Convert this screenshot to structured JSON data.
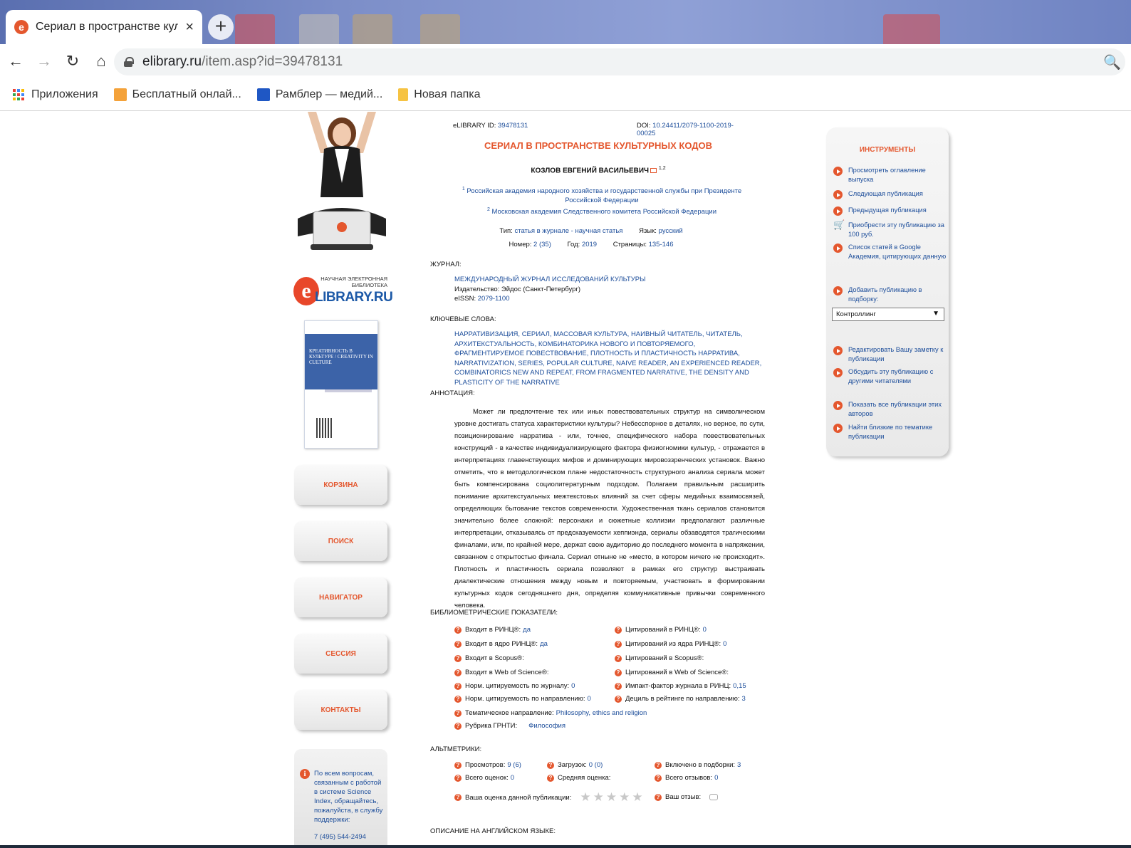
{
  "browser": {
    "tab_title": "Сериал в пространстве культур",
    "tab_close": "×",
    "new_tab": "+",
    "url_host": "elibrary.ru",
    "url_path": "/item.asp?id=39478131",
    "bookmarks": [
      "Приложения",
      "Бесплатный онлай...",
      "Рамблер — медий...",
      "Новая папка"
    ]
  },
  "left": {
    "logo_caption": "НАУЧНАЯ ЭЛЕКТРОННАЯ БИБЛИОТЕКА",
    "logo_brand": "LIBRARY.RU",
    "logo_letter": "e",
    "cover_title": "КРЕАТИВНОСТЬ В КУЛЬТУРЕ / CREATIVITY IN CULTURE",
    "nav": [
      "КОРЗИНА",
      "ПОИСК",
      "НАВИГАТОР",
      "СЕССИЯ",
      "КОНТАКТЫ"
    ],
    "support_text": "По всем вопросам, связанным с работой в системе Science Index, обращайтесь, пожалуйста, в службу поддержки:",
    "support_phone": "7 (495) 544-2494"
  },
  "article": {
    "elibrary_id_label": "eLIBRARY ID:",
    "elibrary_id": "39478131",
    "doi_label": "DOI:",
    "doi": "10.24411/2079-1100-2019-00025",
    "title": "СЕРИАЛ В ПРОСТРАНСТВЕ КУЛЬТУРНЫХ КОДОВ",
    "author": "КОЗЛОВ ЕВГЕНИЙ ВАСИЛЬЕВИЧ",
    "author_sup": "1,2",
    "aff1_sup": "1",
    "aff1": "Российская академия народного хозяйства и государственной службы при Президенте Российской Федерации",
    "aff2_sup": "2",
    "aff2": "Московская академия Следственного комитета Российской Федерации",
    "type_label": "Тип:",
    "type": "статья в журнале - научная статья",
    "lang_label": "Язык:",
    "lang": "русский",
    "issue_label": "Номер:",
    "issue": "2 (35)",
    "year_label": "Год:",
    "year": "2019",
    "pages_label": "Страницы:",
    "pages": "135-146",
    "journal_head": "ЖУРНАЛ:",
    "journal_name": "МЕЖДУНАРОДНЫЙ ЖУРНАЛ ИССЛЕДОВАНИЙ КУЛЬТУРЫ",
    "publisher_label": "Издательство:",
    "publisher": "Эйдос (Санкт-Петербург)",
    "eissn_label": "eISSN:",
    "eissn": "2079-1100",
    "keywords_head": "КЛЮЧЕВЫЕ СЛОВА:",
    "keywords": "НАРРАТИВИЗАЦИЯ, СЕРИАЛ, МАССОВАЯ КУЛЬТУРА, НАИВНЫЙ ЧИТАТЕЛЬ, ЧИТАТЕЛЬ, АРХИТЕКСТУАЛЬНОСТЬ, КОМБИНАТОРИКА НОВОГО И ПОВТОРЯЕМОГО, ФРАГМЕНТИРУЕМОЕ ПОВЕСТВОВАНИЕ, ПЛОТНОСТЬ И ПЛАСТИЧНОСТЬ НАРРАТИВА, NARRATIVIZATION, SERIES, POPULAR CULTURE, NAIVE READER, AN EXPERIENCED READER, COMBINATORICS NEW AND REPEAT, FROM FRAGMENTED NARRATIVE, THE DENSITY AND PLASTICITY OF THE NARRATIVE",
    "abstract_head": "АННОТАЦИЯ:",
    "abstract": "Может ли предпочтение тех или иных повествовательных структур на символическом уровне достигать статуса характеристики культуры? Небесспорное в деталях, но верное, по сути, позиционирование нарратива - или, точнее, специфического набора повествовательных конструкций - в качестве индивидуализирующего фактора физиогномики культур, - отражается в интерпретациях главенствующих мифов и доминирующих мировоззренческих установок. Важно отметить, что в методологическом плане недостаточность структурного анализа сериала может быть компенсирована социолитературным подходом. Полагаем правильным расширить понимание архитекстуальных межтекстовых влияний за счет сферы медийных взаимосвязей, определяющих бытование текстов современности. Художественная ткань сериалов становится значительно более сложной: персонажи и сюжетные коллизии предполагают различные интерпретации, отказываясь от предсказуемости хеппиэнда, сериалы обзаводятся трагическими финалами, или, по крайней мере, держат свою аудиторию до последнего момента в напряжении, связанном с открытостью финала. Сериал отныне не «место, в котором ничего не происходит». Плотность и пластичность сериала позволяют в рамках его структур выстраивать диалектические отношения между новым и повторяемым, участвовать в формировании культурных кодов сегодняшнего дня, определяя коммуникативные привычки современного человека.",
    "biblio_head": "БИБЛИОМЕТРИЧЕСКИЕ ПОКАЗАТЕЛИ:",
    "biblio_left": [
      {
        "label": "Входит в РИНЦ®:",
        "value": "да"
      },
      {
        "label": "Входит в ядро РИНЦ®:",
        "value": "да"
      },
      {
        "label": "Входит в Scopus®:",
        "value": ""
      },
      {
        "label": "Входит в Web of Science®:",
        "value": ""
      },
      {
        "label": "Норм. цитируемость по журналу:",
        "value": "0"
      },
      {
        "label": "Норм. цитируемость по направлению:",
        "value": "0"
      },
      {
        "label": "Тематическое направление:",
        "value": "Philosophy, ethics and religion"
      },
      {
        "label": "Рубрика ГРНТИ:",
        "value": "Философия"
      }
    ],
    "biblio_right": [
      {
        "label": "Цитирований в РИНЦ®:",
        "value": "0"
      },
      {
        "label": "Цитирований из ядра РИНЦ®:",
        "value": "0"
      },
      {
        "label": "Цитирований в Scopus®:",
        "value": ""
      },
      {
        "label": "Цитирований в Web of Science®:",
        "value": ""
      },
      {
        "label": "Импакт-фактор журнала в РИНЦ:",
        "value": "0,15"
      },
      {
        "label": "Дециль в рейтинге по направлению:",
        "value": "3"
      }
    ],
    "alt_head": "АЛЬТМЕТРИКИ:",
    "alt": {
      "views_label": "Просмотров:",
      "views": "9 (6)",
      "downloads_label": "Загрузок:",
      "downloads": "0 (0)",
      "collections_label": "Включено в подборки:",
      "collections": "3",
      "ratings_label": "Всего оценок:",
      "ratings": "0",
      "avg_label": "Средняя оценка:",
      "avg": "",
      "reviews_label": "Всего отзывов:",
      "reviews": "0",
      "your_rating_label": "Ваша оценка данной публикации:",
      "stars": "★★★★★",
      "your_review_label": "Ваш отзыв:"
    },
    "english_head": "ОПИСАНИЕ НА АНГЛИЙСКОМ ЯЗЫКЕ:"
  },
  "tools": {
    "title": "ИНСТРУМЕНТЫ",
    "items": [
      "Просмотреть оглавление выпуска",
      "Следующая публикация",
      "Предыдущая публикация",
      "Приобрести эту публикацию за 100 руб.",
      "Список статей в Google Академия, цитирующих данную",
      "Добавить публикацию в подборку:",
      "Редактировать Вашу заметку к публикации",
      "Обсудить эту публикацию с другими читателями",
      "Показать все публикации этих авторов",
      "Найти близкие по тематике публикации"
    ],
    "select_value": "Контроллинг",
    "select_arrow": "▼"
  },
  "colors": {
    "accent": "#e4572e",
    "link": "#1c4d9a"
  },
  "icons": {
    "back": "←",
    "forward": "→",
    "reload": "↻",
    "home": "⌂",
    "zoom": "🔍",
    "question": "?",
    "info": "i",
    "cart": "🛒"
  }
}
